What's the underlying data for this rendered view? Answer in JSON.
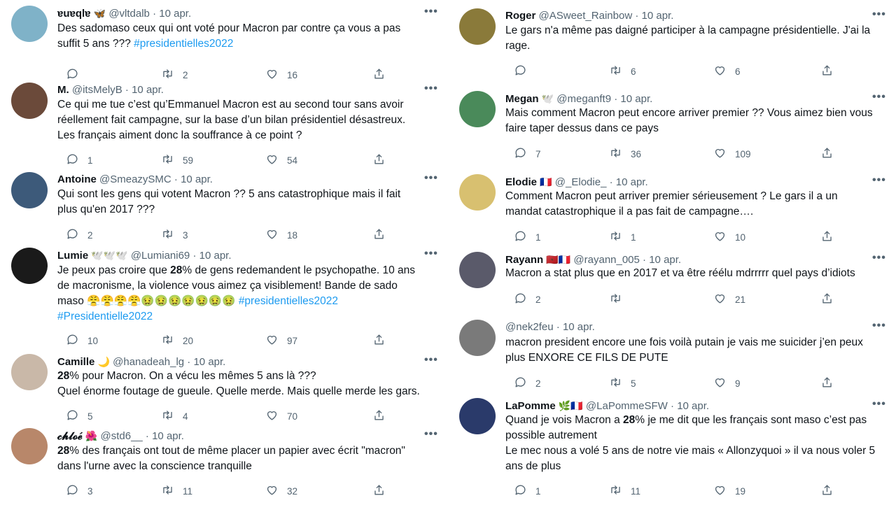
{
  "left": [
    {
      "name": "ɐuɐqlɐ",
      "emoji": "🦋",
      "handle": "@vltdalb",
      "date": "10 apr.",
      "lines": [
        [
          {
            "t": "Des sadomaso ceux qui ont voté pour Macron par contre ça vous a pas"
          }
        ],
        [
          {
            "t": "suffit 5 ans ??? "
          },
          {
            "t": "#presidentielles2022",
            "tag": true
          }
        ]
      ],
      "replies": "",
      "retweets": "2",
      "likes": "16",
      "avatar": "#7fb2c8"
    },
    {
      "name": "M.",
      "emoji": "",
      "handle": "@itsMelyB",
      "date": "10 apr.",
      "lines": [
        [
          {
            "t": "Ce qui me tue c’est qu’Emmanuel Macron est au second tour sans avoir"
          }
        ],
        [
          {
            "t": "réellement fait campagne, sur la base d’un bilan présidentiel désastreux."
          }
        ],
        [
          {
            "t": "Les français aiment donc la souffrance à ce point ?"
          }
        ]
      ],
      "replies": "1",
      "retweets": "59",
      "likes": "54",
      "avatar": "#6b4a3a"
    },
    {
      "name": "Antoine",
      "emoji": "",
      "handle": "@SmeazySMC",
      "date": "10 apr.",
      "lines": [
        [
          {
            "t": "Qui sont les gens qui votent Macron ?? 5 ans catastrophique mais il fait"
          }
        ],
        [
          {
            "t": "plus qu'en 2017 ???"
          }
        ]
      ],
      "replies": "2",
      "retweets": "3",
      "likes": "18",
      "avatar": "#3d5a7a"
    },
    {
      "name": "Lumie",
      "emoji": "🕊️🕊️🕊️",
      "handle": "@Lumiani69",
      "date": "10 apr.",
      "lines": [
        [
          {
            "t": "Je peux pas croire que "
          },
          {
            "t": "28",
            "b": true
          },
          {
            "t": "% de gens redemandent le psychopathe. 10 ans"
          }
        ],
        [
          {
            "t": "de macronisme, la violence vous aimez ça visiblement! Bande de sado"
          }
        ],
        [
          {
            "t": "maso 😤😤😤😤🤢🤢🤢🤢🤢🤢🤢 "
          },
          {
            "t": "#presidentielles2022",
            "tag": true
          }
        ],
        [
          {
            "t": "#Presidentielle2022",
            "tag": true
          }
        ]
      ],
      "replies": "10",
      "retweets": "20",
      "likes": "97",
      "avatar": "#1a1a1a"
    },
    {
      "name": "Camille",
      "emoji": "🌙",
      "handle": "@hanadeah_lg",
      "date": "10 apr.",
      "lines": [
        [
          {
            "t": "28",
            "b": true
          },
          {
            "t": "% pour Macron. On a vécu les mêmes 5 ans là ???"
          }
        ],
        [
          {
            "t": "Quel énorme foutage de gueule. Quelle merde. Mais quelle merde les gars."
          }
        ]
      ],
      "replies": "5",
      "retweets": "4",
      "likes": "70",
      "avatar": "#c9b8a8"
    },
    {
      "name": "𝓬𝓱𝓵𝓸𝓮́",
      "emoji": "🌺",
      "handle": "@std6__",
      "date": "10 apr.",
      "lines": [
        [
          {
            "t": "28",
            "b": true
          },
          {
            "t": "% des français ont tout de même placer un papier avec écrit \"macron\""
          }
        ],
        [
          {
            "t": "dans l'urne avec la conscience tranquille"
          }
        ]
      ],
      "replies": "3",
      "retweets": "11",
      "likes": "32",
      "avatar": "#b8876a"
    }
  ],
  "right": [
    {
      "name": "Roger",
      "emoji": "",
      "handle": "@ASweet_Rainbow",
      "date": "10 apr.",
      "lines": [
        [
          {
            "t": "Le gars n'a même pas daigné participer à la campagne présidentielle. J'ai la"
          }
        ],
        [
          {
            "t": "rage."
          }
        ]
      ],
      "replies": "",
      "retweets": "6",
      "likes": "6",
      "avatar": "#8a7a3a"
    },
    {
      "name": "Megan",
      "emoji": "🕊️",
      "handle": "@meganft9",
      "date": "10 apr.",
      "lines": [
        [
          {
            "t": "Mais comment Macron peut encore arriver premier ?? Vous aimez bien vous"
          }
        ],
        [
          {
            "t": "faire taper dessus dans ce pays"
          }
        ]
      ],
      "replies": "7",
      "retweets": "36",
      "likes": "109",
      "avatar": "#4a8a5a"
    },
    {
      "name": "Elodie",
      "emoji": "🇫🇷",
      "handle": "@_Elodie_",
      "date": "10 apr.",
      "lines": [
        [
          {
            "t": "Comment Macron peut arriver premier sérieusement ? Le gars il a un"
          }
        ],
        [
          {
            "t": "mandat catastrophique il a pas fait de campagne…."
          }
        ]
      ],
      "replies": "1",
      "retweets": "1",
      "likes": "10",
      "avatar": "#d8c070"
    },
    {
      "name": "Rayann",
      "emoji": "🇲🇦🇫🇷",
      "handle": "@rayann_005",
      "date": "10 apr.",
      "lines": [
        [
          {
            "t": "Macron a stat plus que en 2017 et va être réélu mdrrrrr quel pays d’idiots"
          }
        ]
      ],
      "replies": "2",
      "retweets": "",
      "likes": "21",
      "avatar": "#5a5a6a"
    },
    {
      "name": "",
      "emoji": "",
      "handle": "@nek2feu",
      "date": "10 apr.",
      "lines": [
        [
          {
            "t": "macron president encore une fois voilà putain je vais me suicider j’en peux"
          }
        ],
        [
          {
            "t": "plus ENXORE CE FILS DE PUTE"
          }
        ]
      ],
      "replies": "2",
      "retweets": "5",
      "likes": "9",
      "avatar": "#7a7a7a"
    },
    {
      "name": "LaPomme",
      "emoji": "🌿🇫🇷",
      "handle": "@LaPommeSFW",
      "date": "10 apr.",
      "lines": [
        [
          {
            "t": "Quand je vois Macron a "
          },
          {
            "t": "28",
            "b": true
          },
          {
            "t": "% je me dit que les français sont maso c’est pas"
          }
        ],
        [
          {
            "t": "possible autrement"
          }
        ],
        [
          {
            "t": "Le mec nous a volé 5 ans de notre vie mais « Allonzyquoi » il va nous voler 5"
          }
        ],
        [
          {
            "t": "ans de plus"
          }
        ]
      ],
      "replies": "1",
      "retweets": "11",
      "likes": "19",
      "avatar": "#2a3a6a"
    }
  ],
  "ui": {
    "dot": "·",
    "more": "•••"
  }
}
